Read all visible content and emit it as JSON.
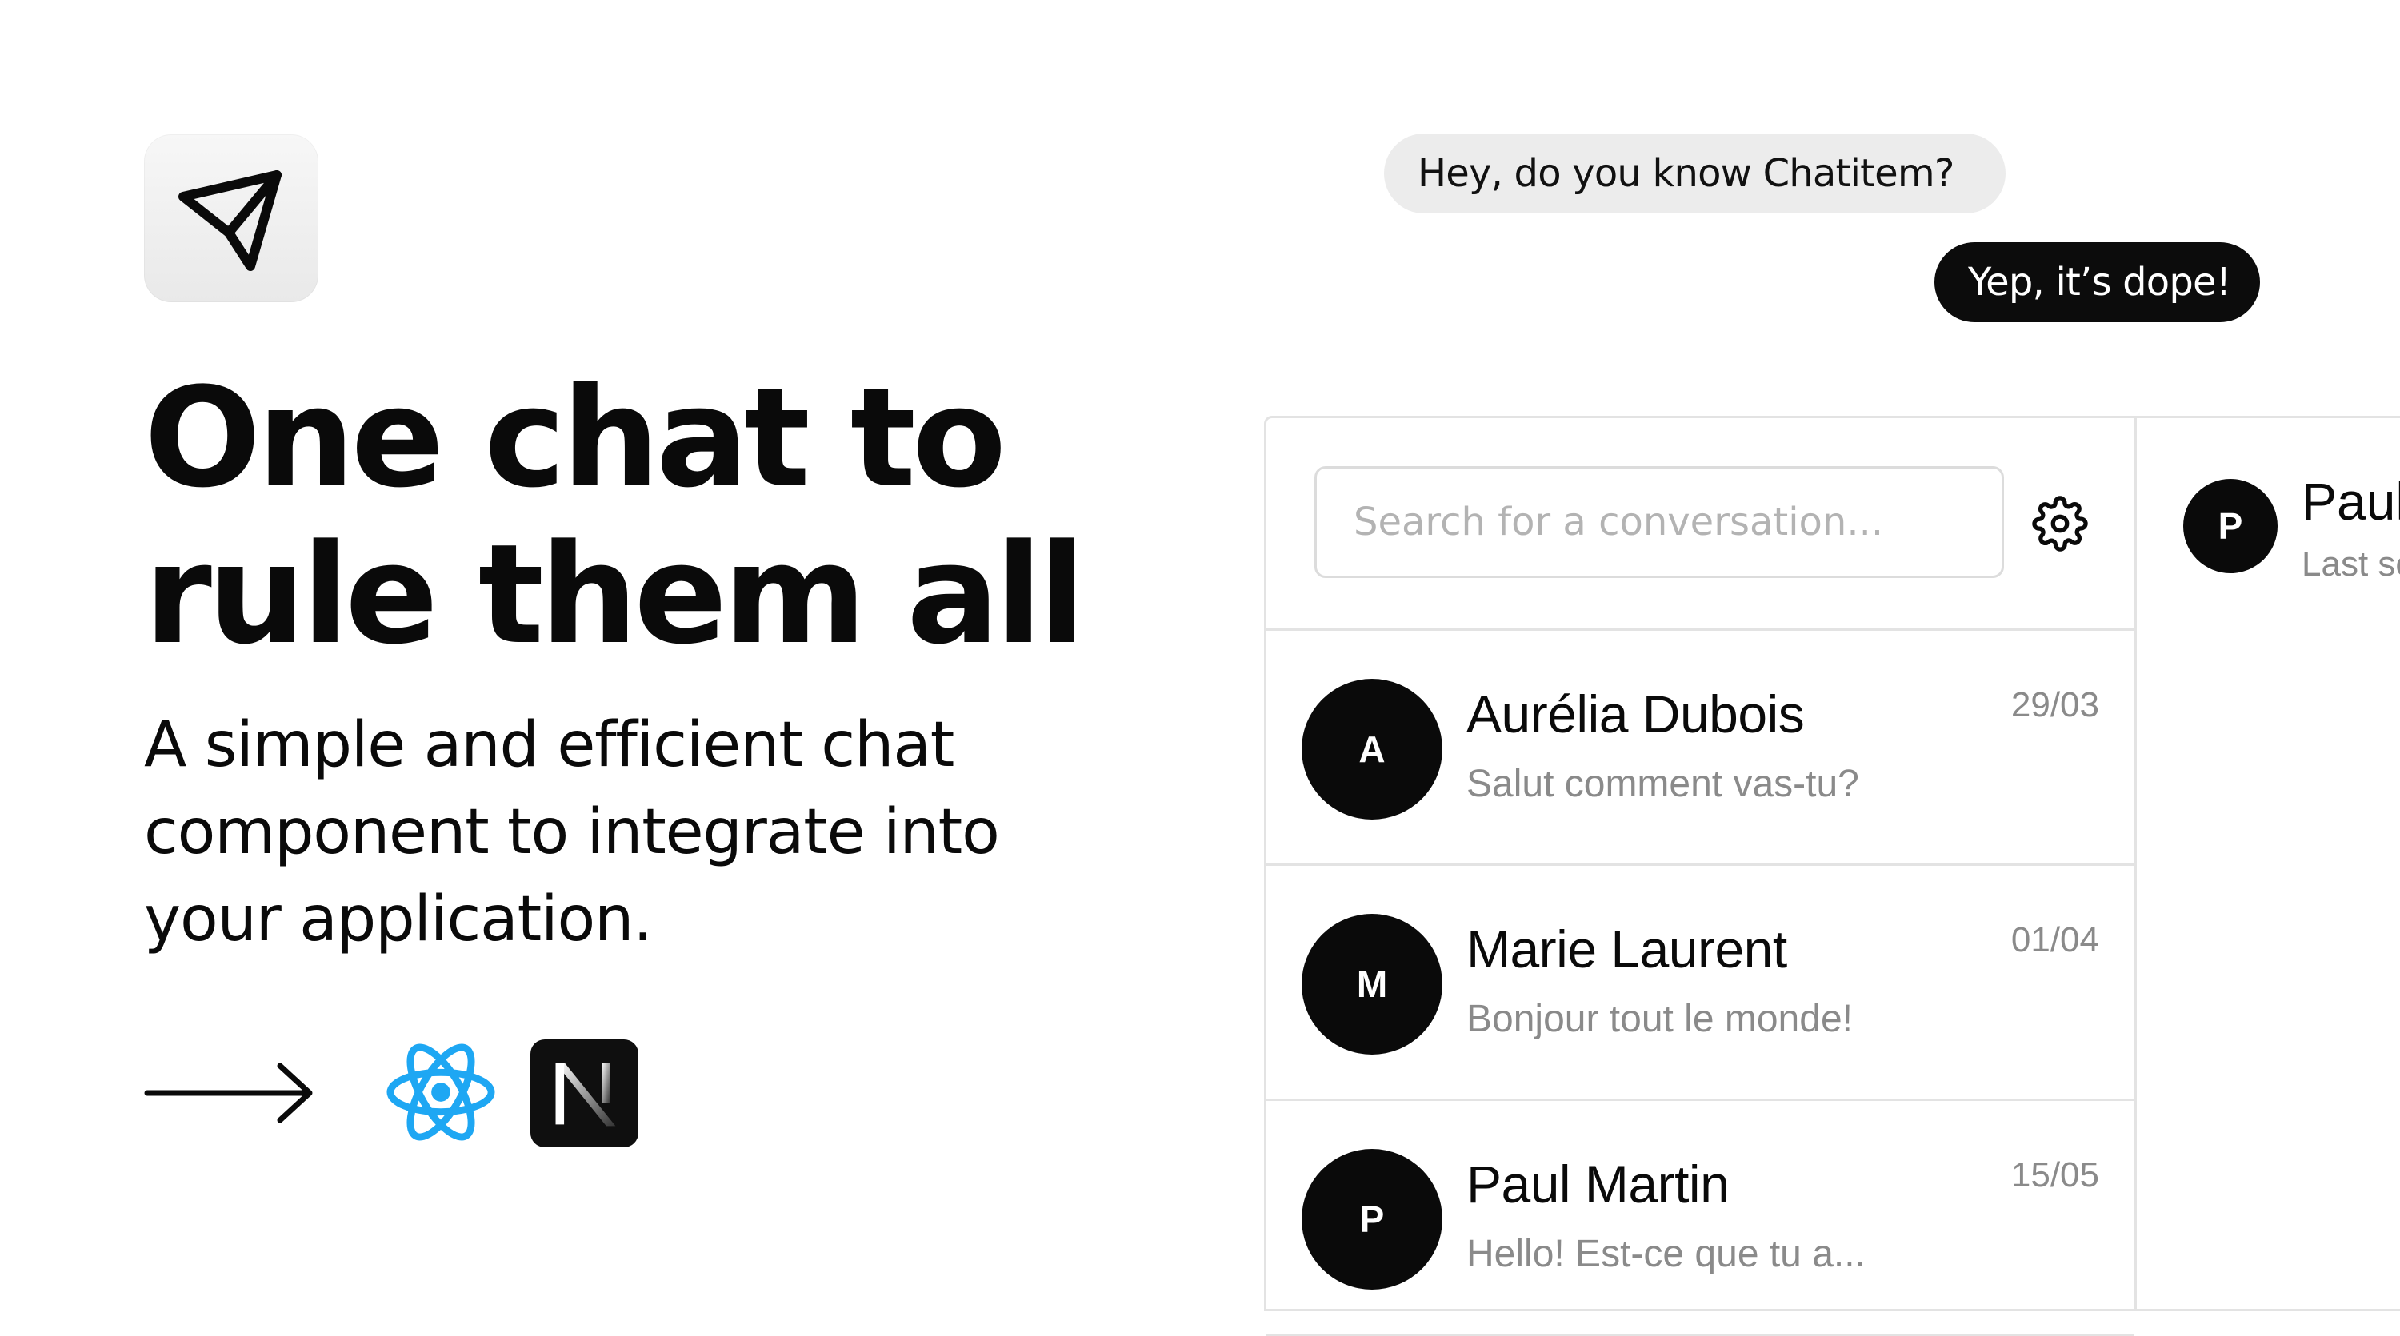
{
  "hero": {
    "title_line1": "One chat to",
    "title_line2": "rule them all",
    "subtitle_line1": "A simple and efficient chat",
    "subtitle_line2": "component to integrate into",
    "subtitle_line3": "your application.",
    "logo_icon": "paper-plane-icon",
    "tech_icons": [
      "arrow-right-icon",
      "react-icon",
      "nextjs-icon"
    ]
  },
  "bubbles": {
    "received": "Hey, do you know Chatitem?",
    "sent": "Yep, it’s dope!"
  },
  "chat": {
    "search": {
      "placeholder": "Search for a conversation...",
      "value": ""
    },
    "settings_icon": "gear-icon",
    "conversations": [
      {
        "initial": "A",
        "name": "Aurélia Dubois",
        "preview": "Salut comment vas-tu?",
        "date": "29/03"
      },
      {
        "initial": "M",
        "name": "Marie Laurent",
        "preview": "Bonjour tout le monde!",
        "date": "01/04"
      },
      {
        "initial": "P",
        "name": "Paul Martin",
        "preview": "Hello! Est-ce que tu a...",
        "date": "15/05"
      }
    ],
    "thread": {
      "initial": "P",
      "name": "Paul",
      "status": "Last se"
    }
  },
  "colors": {
    "ink": "#0a0a0a",
    "received_bubble": "#ececec",
    "sent_bubble": "#0c0c0c",
    "react": "#1ea7f3",
    "border": "#e3e3e3",
    "muted_text": "#8a8a8a"
  }
}
